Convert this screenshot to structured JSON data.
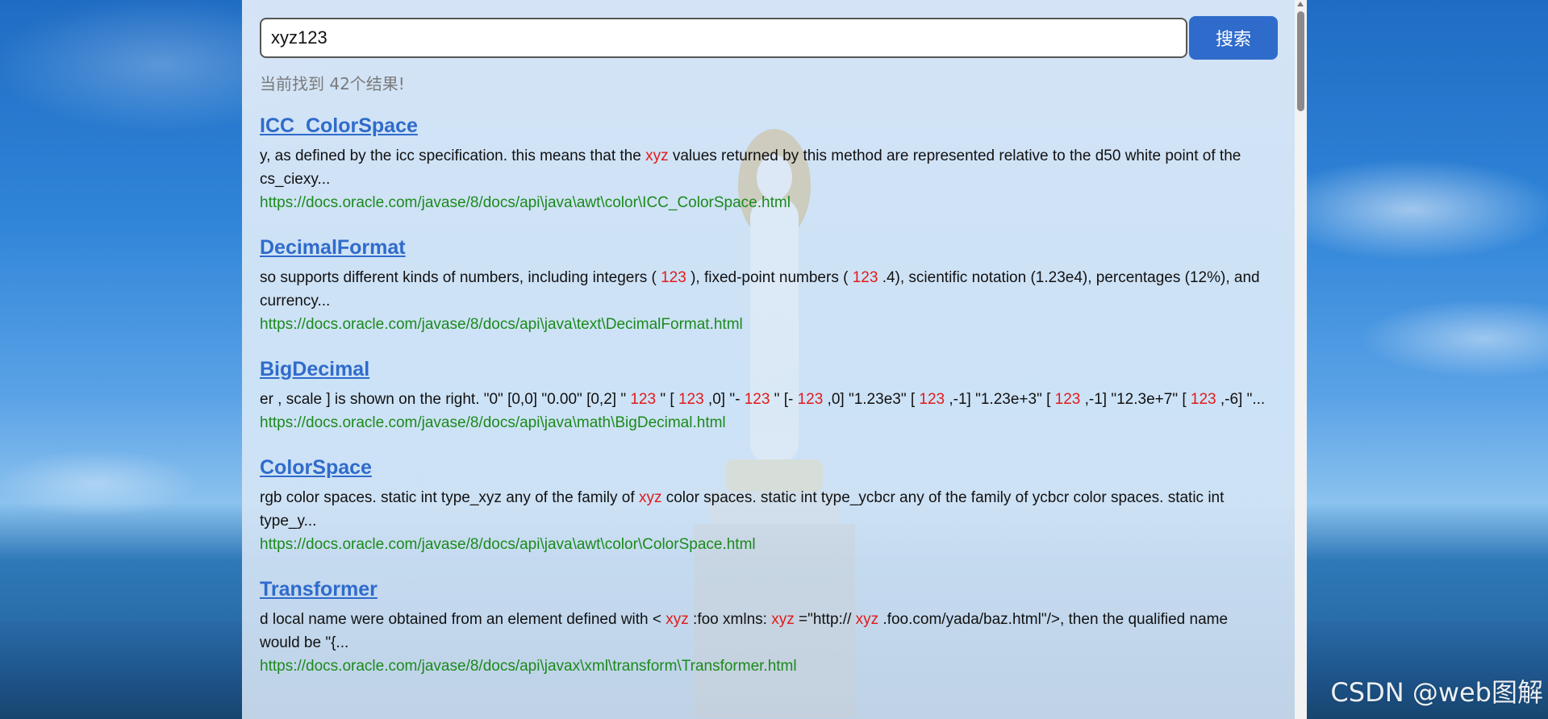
{
  "search": {
    "value": "xyz123",
    "button_label": "搜索"
  },
  "result_count_text": "当前找到 42个结果!",
  "results": [
    {
      "title": "ICC_ColorSpace",
      "snippet": [
        {
          "t": "y, as defined by the icc specification. this means that the "
        },
        {
          "t": "xyz",
          "hl": true
        },
        {
          "t": " values returned by this method are represented relative to the d50 white point of the cs_ciexy..."
        }
      ],
      "url": "https://docs.oracle.com/javase/8/docs/api\\java\\awt\\color\\ICC_ColorSpace.html"
    },
    {
      "title": "DecimalFormat",
      "snippet": [
        {
          "t": "so supports different kinds of numbers, including integers ( "
        },
        {
          "t": "123",
          "hl": true
        },
        {
          "t": " ), fixed-point numbers ( "
        },
        {
          "t": "123",
          "hl": true
        },
        {
          "t": " .4), scientific notation (1.23e4), percentages (12%), and currency..."
        }
      ],
      "url": "https://docs.oracle.com/javase/8/docs/api\\java\\text\\DecimalFormat.html"
    },
    {
      "title": "BigDecimal",
      "snippet": [
        {
          "t": "er , scale ] is shown on the right. \"0\" [0,0] \"0.00\" [0,2] \" "
        },
        {
          "t": "123",
          "hl": true
        },
        {
          "t": " \" [ "
        },
        {
          "t": "123",
          "hl": true
        },
        {
          "t": " ,0] \"- "
        },
        {
          "t": "123",
          "hl": true
        },
        {
          "t": " \" [- "
        },
        {
          "t": "123",
          "hl": true
        },
        {
          "t": " ,0] \"1.23e3\" [ "
        },
        {
          "t": "123",
          "hl": true
        },
        {
          "t": " ,-1] \"1.23e+3\" [ "
        },
        {
          "t": "123",
          "hl": true
        },
        {
          "t": " ,-1] \"12.3e+7\" [ "
        },
        {
          "t": "123",
          "hl": true
        },
        {
          "t": " ,-6] \"..."
        }
      ],
      "url": "https://docs.oracle.com/javase/8/docs/api\\java\\math\\BigDecimal.html"
    },
    {
      "title": "ColorSpace",
      "snippet": [
        {
          "t": "rgb color spaces. static int type_xyz any of the family of "
        },
        {
          "t": "xyz",
          "hl": true
        },
        {
          "t": " color spaces. static int type_ycbcr any of the family of ycbcr color spaces. static int type_y..."
        }
      ],
      "url": "https://docs.oracle.com/javase/8/docs/api\\java\\awt\\color\\ColorSpace.html"
    },
    {
      "title": "Transformer",
      "snippet": [
        {
          "t": "d local name were obtained from an element defined with < "
        },
        {
          "t": "xyz",
          "hl": true
        },
        {
          "t": " :foo xmlns: "
        },
        {
          "t": "xyz",
          "hl": true
        },
        {
          "t": " =\"http:// "
        },
        {
          "t": "xyz",
          "hl": true
        },
        {
          "t": " .foo.com/yada/baz.html\"/>, then the qualified name would be \"{..."
        }
      ],
      "url": "https://docs.oracle.com/javase/8/docs/api\\javax\\xml\\transform\\Transformer.html"
    }
  ],
  "watermark": "CSDN @web图解",
  "colors": {
    "link": "#2f6bcb",
    "highlight": "#e21a1a",
    "url": "#1b8a1b",
    "button": "#2f6bcb"
  }
}
